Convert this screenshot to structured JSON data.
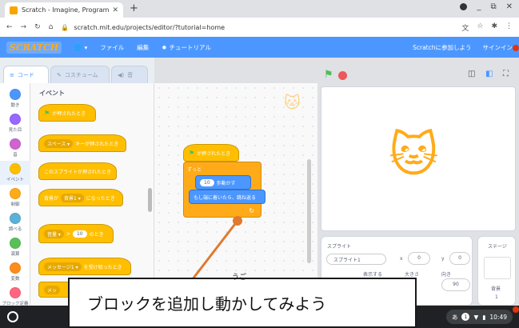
{
  "browser": {
    "tab_title": "Scratch - Imagine, Program, Sh",
    "url": "scratch.mit.edu/projects/editor/?tutorial=home"
  },
  "menu": {
    "logo": "SCRATCH",
    "file": "ファイル",
    "edit": "編集",
    "tutorial": "チュートリアル",
    "join": "Scratchに参加しよう",
    "signin": "サインイン"
  },
  "tabs": {
    "code": "コード",
    "costume": "コスチューム",
    "sound": "音"
  },
  "categories": [
    {
      "label": "動き",
      "color": "#4c97ff"
    },
    {
      "label": "見た目",
      "color": "#9966ff"
    },
    {
      "label": "音",
      "color": "#cf63cf"
    },
    {
      "label": "イベント",
      "color": "#ffbf00"
    },
    {
      "label": "制御",
      "color": "#ffab19"
    },
    {
      "label": "調べる",
      "color": "#5cb1d6"
    },
    {
      "label": "演算",
      "color": "#59c059"
    },
    {
      "label": "変数",
      "color": "#ff8c1a"
    },
    {
      "label": "ブロック定義",
      "color": "#ff6680"
    }
  ],
  "palette": {
    "title": "イベント",
    "flag_clicked": "が押されたとき",
    "key_dd": "スペース ▾",
    "key_suffix": "キーが押されたとき",
    "sprite_clicked": "このスプライトが押されたとき",
    "backdrop_prefix": "背景が",
    "backdrop_dd": "背景1 ▾",
    "backdrop_suffix": "になったとき",
    "volume_dd": "音量 ▾",
    "volume_val": "10",
    "volume_suffix": "のとき",
    "msg_dd": "メッセージ1 ▾",
    "msg_suffix": "を受け取ったとき",
    "msg2": "メッ"
  },
  "script": {
    "hat": "が押されたとき",
    "forever": "ずっと",
    "move_val": "10",
    "move_suffix": "歩動かす",
    "bounce": "もし端に着いたら、跳ね返る",
    "loop_arrow": "↻"
  },
  "sprite_panel": {
    "title": "スプライト",
    "name": "スプライト1",
    "x_label": "x",
    "x_val": "0",
    "y_label": "y",
    "y_val": "0",
    "show_label": "表示する",
    "size_label": "大きさ",
    "dir_label": "向き",
    "dir_val": "90"
  },
  "stage_panel": {
    "title": "ステージ",
    "backdrop_label": "背景",
    "backdrop_count": "1"
  },
  "shelf": {
    "ime": "あ",
    "badge": "1",
    "time": "10:49"
  },
  "callout": {
    "text": "ブロックを追加し動かしてみよう",
    "ruby": "うご"
  }
}
